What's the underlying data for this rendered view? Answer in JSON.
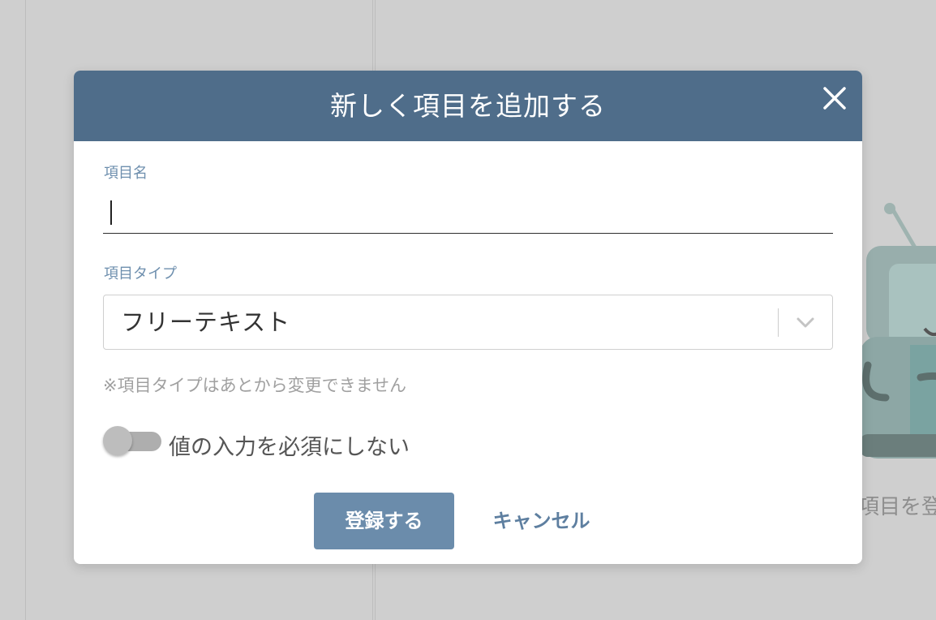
{
  "background": {
    "empty_state_text": "項目を登"
  },
  "modal": {
    "title": "新しく項目を追加する",
    "close_icon": "close-icon",
    "item_name": {
      "label": "項目名",
      "value": ""
    },
    "item_type": {
      "label": "項目タイプ",
      "selected": "フリーテキスト",
      "chevron_icon": "chevron-down-icon"
    },
    "note": "※項目タイプはあとから変更できません",
    "required_toggle": {
      "label": "値の入力を必須にしない",
      "on": false
    },
    "buttons": {
      "submit": "登録する",
      "cancel": "キャンセル"
    }
  },
  "colors": {
    "header": "#4f6d8a",
    "primary_button": "#6b8cab",
    "label_accent": "#6e8fae",
    "overlay": "#cfcfcf"
  }
}
